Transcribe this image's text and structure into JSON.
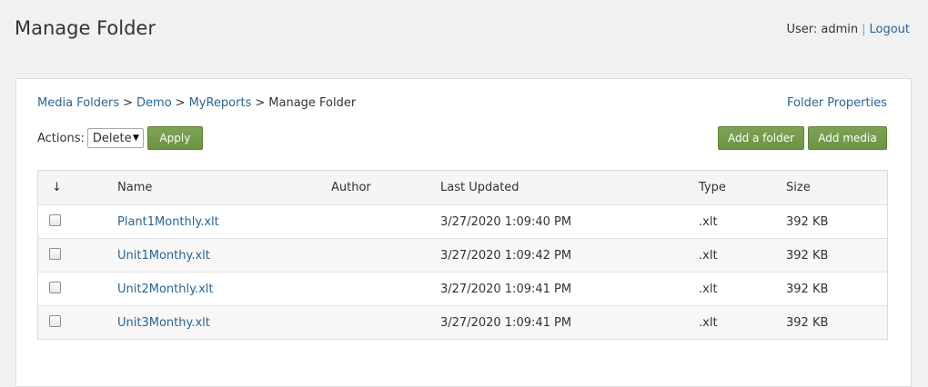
{
  "header": {
    "title": "Manage Folder",
    "user_text": "User: admin",
    "separator": "|",
    "logout_label": "Logout"
  },
  "breadcrumb": {
    "items": [
      "Media Folders",
      "Demo",
      "MyReports"
    ],
    "current": "Manage Folder",
    "separator": ">"
  },
  "folder_properties_label": "Folder Properties",
  "actions": {
    "label": "Actions:",
    "selected": "Delete",
    "apply_label": "Apply"
  },
  "buttons": {
    "add_folder": "Add a folder",
    "add_media": "Add media"
  },
  "table": {
    "sort_icon": "↓",
    "columns": [
      "Name",
      "Author",
      "Last Updated",
      "Type",
      "Size"
    ],
    "rows": [
      {
        "name": "Plant1Monthly.xlt",
        "author": "",
        "updated": "3/27/2020 1:09:40 PM",
        "type": ".xlt",
        "size": "392 KB"
      },
      {
        "name": "Unit1Monthy.xlt",
        "author": "",
        "updated": "3/27/2020 1:09:42 PM",
        "type": ".xlt",
        "size": "392 KB"
      },
      {
        "name": "Unit2Monthly.xlt",
        "author": "",
        "updated": "3/27/2020 1:09:41 PM",
        "type": ".xlt",
        "size": "392 KB"
      },
      {
        "name": "Unit3Monthy.xlt",
        "author": "",
        "updated": "3/27/2020 1:09:41 PM",
        "type": ".xlt",
        "size": "392 KB"
      }
    ]
  },
  "colors": {
    "link": "#2a6496",
    "button": "#6c9344",
    "background": "#f0f1f2"
  }
}
